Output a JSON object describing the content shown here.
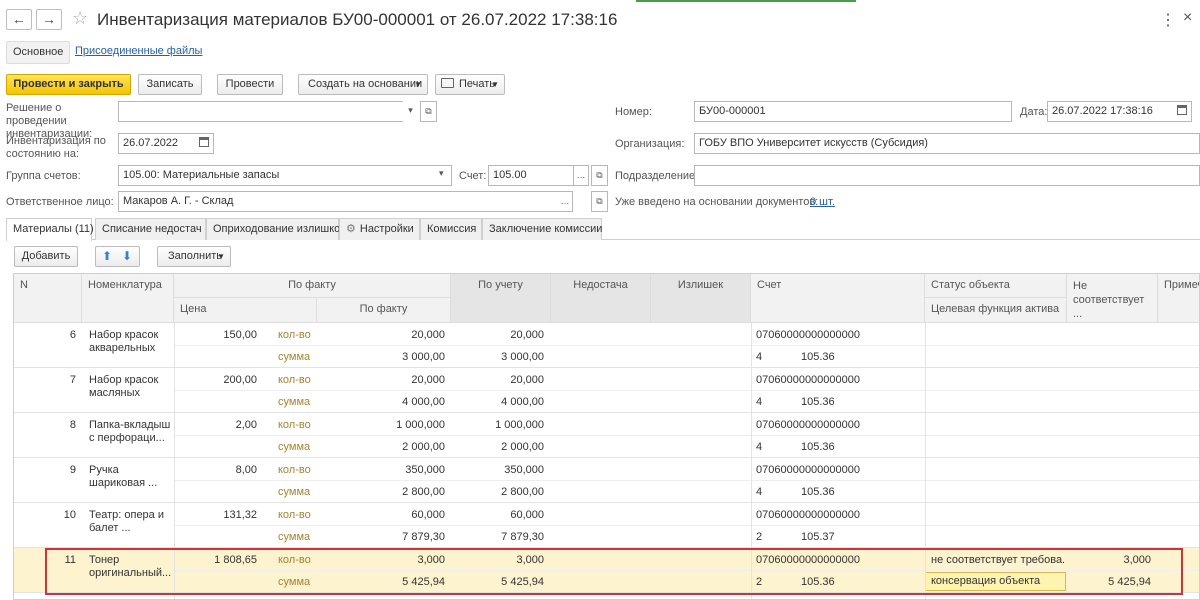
{
  "window": {
    "title": "Инвентаризация материалов БУ00-000001 от 26.07.2022 17:38:16",
    "back": "←",
    "forward": "→",
    "star": "☆",
    "more": "⋮",
    "close": "×"
  },
  "section_tabs": {
    "main": "Основное",
    "files": "Присоединенные файлы"
  },
  "toolbar": {
    "post_close": "Провести и закрыть",
    "save": "Записать",
    "post": "Провести",
    "create_based": "Создать на основании",
    "print": "Печать"
  },
  "form": {
    "decision_label": "Решение о проведении инвентаризации:",
    "decision_value": "",
    "inv_date_label": "Инвентаризация по состоянию на:",
    "inv_date_value": "26.07.2022",
    "group_label": "Группа счетов:",
    "group_value": "105.00: Материальные запасы",
    "account_label": "Счет:",
    "account_value": "105.00",
    "responsible_label": "Ответственное лицо:",
    "responsible_value": "Макаров А. Г. - Склад",
    "number_label": "Номер:",
    "number_value": "БУ00-000001",
    "date_label": "Дата:",
    "date_value": "26.07.2022 17:38:16",
    "org_label": "Организация:",
    "org_value": "ГОБУ ВПО Университет искусств (Субсидия)",
    "dept_label": "Подразделение:",
    "dept_value": "",
    "based_label": "Уже введено на основании документов:",
    "based_value": "0 шт."
  },
  "tabs": [
    "Материалы (11)",
    "Списание недостач",
    "Оприходование излишков",
    "Настройки",
    "Комиссия",
    "Заключение комиссии"
  ],
  "table_toolbar": {
    "add": "Добавить",
    "fill": "Заполнить"
  },
  "columns": {
    "n": "N",
    "nomenclature": "Номенклатура",
    "fact": "По факту",
    "price": "Цена",
    "fact_sub": "По факту",
    "account_qty": "По учету",
    "shortage": "Недостача",
    "surplus": "Излишек",
    "account": "Счет",
    "status": "Статус объекта",
    "target": "Целевая функция актива",
    "not_match": "Не соответствует ...",
    "note": "Примеч"
  },
  "labels": {
    "qty": "кол-во",
    "sum": "сумма"
  },
  "rows": [
    {
      "n": "6",
      "name1": "Набор красок",
      "name2": "акварельных",
      "price": "150,00",
      "fact_qty": "20,000",
      "acc_qty": "20,000",
      "fact_sum": "3 000,00",
      "acc_sum": "3 000,00",
      "acct1": "07060000000000000",
      "acct_a": "4",
      "acct_b": "105.36",
      "status": "",
      "target": "",
      "nm_qty": "",
      "nm_sum": ""
    },
    {
      "n": "7",
      "name1": "Набор красок",
      "name2": "масляных",
      "price": "200,00",
      "fact_qty": "20,000",
      "acc_qty": "20,000",
      "fact_sum": "4 000,00",
      "acc_sum": "4 000,00",
      "acct1": "07060000000000000",
      "acct_a": "4",
      "acct_b": "105.36",
      "status": "",
      "target": "",
      "nm_qty": "",
      "nm_sum": ""
    },
    {
      "n": "8",
      "name1": "Папка-вкладыш",
      "name2": "с перфораци...",
      "price": "2,00",
      "fact_qty": "1 000,000",
      "acc_qty": "1 000,000",
      "fact_sum": "2 000,00",
      "acc_sum": "2 000,00",
      "acct1": "07060000000000000",
      "acct_a": "4",
      "acct_b": "105.36",
      "status": "",
      "target": "",
      "nm_qty": "",
      "nm_sum": ""
    },
    {
      "n": "9",
      "name1": "Ручка",
      "name2": "шариковая ...",
      "price": "8,00",
      "fact_qty": "350,000",
      "acc_qty": "350,000",
      "fact_sum": "2 800,00",
      "acc_sum": "2 800,00",
      "acct1": "07060000000000000",
      "acct_a": "4",
      "acct_b": "105.36",
      "status": "",
      "target": "",
      "nm_qty": "",
      "nm_sum": ""
    },
    {
      "n": "10",
      "name1": "Театр: опера и",
      "name2": "балет ...",
      "price": "131,32",
      "fact_qty": "60,000",
      "acc_qty": "60,000",
      "fact_sum": "7 879,30",
      "acc_sum": "7 879,30",
      "acct1": "07060000000000000",
      "acct_a": "2",
      "acct_b": "105.37",
      "status": "",
      "target": "",
      "nm_qty": "",
      "nm_sum": ""
    },
    {
      "n": "11",
      "name1": "Тонер",
      "name2": "оригинальный...",
      "price": "1 808,65",
      "fact_qty": "3,000",
      "acc_qty": "3,000",
      "fact_sum": "5 425,94",
      "acc_sum": "5 425,94",
      "acct1": "07060000000000000",
      "acct_a": "2",
      "acct_b": "105.36",
      "status": "не соответствует требова...",
      "target": "консервация объекта",
      "nm_qty": "3,000",
      "nm_sum": "5 425,94"
    }
  ],
  "colors": {
    "primary": "#f5c400",
    "link": "#2460a8",
    "highlight_row": "#fdf3cf",
    "highlight_border": "#d1323a"
  }
}
